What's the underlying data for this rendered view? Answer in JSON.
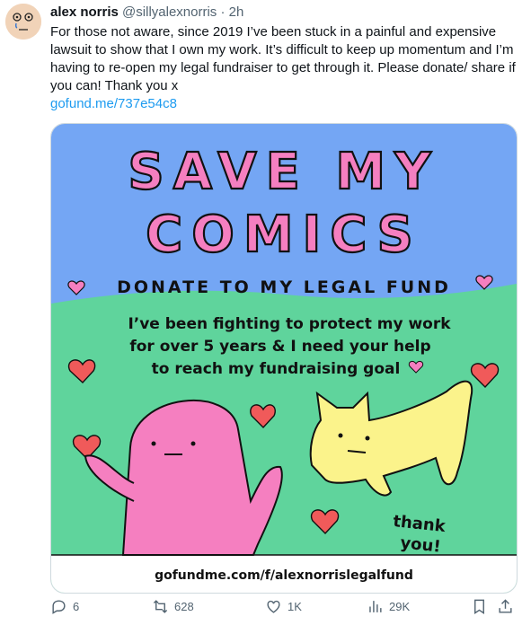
{
  "author": {
    "name": "alex norris",
    "handle": "@sillyalexnorris",
    "separator": "·",
    "time": "2h"
  },
  "tweet": {
    "text": "For those not aware, since 2019 I’ve been stuck in a painful and expensive lawsuit to show that I own my work. It’s difficult to keep up momentum and I’m having to re-open my legal fundraiser to get through it. Please donate/ share if you can! Thank you x",
    "link": "gofund.me/737e54c8"
  },
  "image": {
    "title_line1": "SAVE MY",
    "title_line2": "COMICS",
    "banner": "DONATE TO MY LEGAL FUND",
    "message_line1": "I’ve been fighting to protect my work",
    "message_line2": "for over 5 years & I need your help",
    "message_line3": "to reach my fundraising goal",
    "thanks_line1": "thank",
    "thanks_line2": "you!",
    "url": "gofundme.com/f/alexnorrislegalfund",
    "colors": {
      "sky": "#74a6f4",
      "grass": "#5fd49c",
      "pink": "#f57fc0",
      "yellow": "#fbf38b",
      "heart": "#f05a5a",
      "footer": "#ffffff"
    }
  },
  "actions": {
    "replies": "6",
    "reposts": "628",
    "likes": "1K",
    "views": "29K"
  },
  "icons": [
    "reply-icon",
    "repost-icon",
    "like-icon",
    "views-icon",
    "bookmark-icon",
    "share-icon"
  ]
}
